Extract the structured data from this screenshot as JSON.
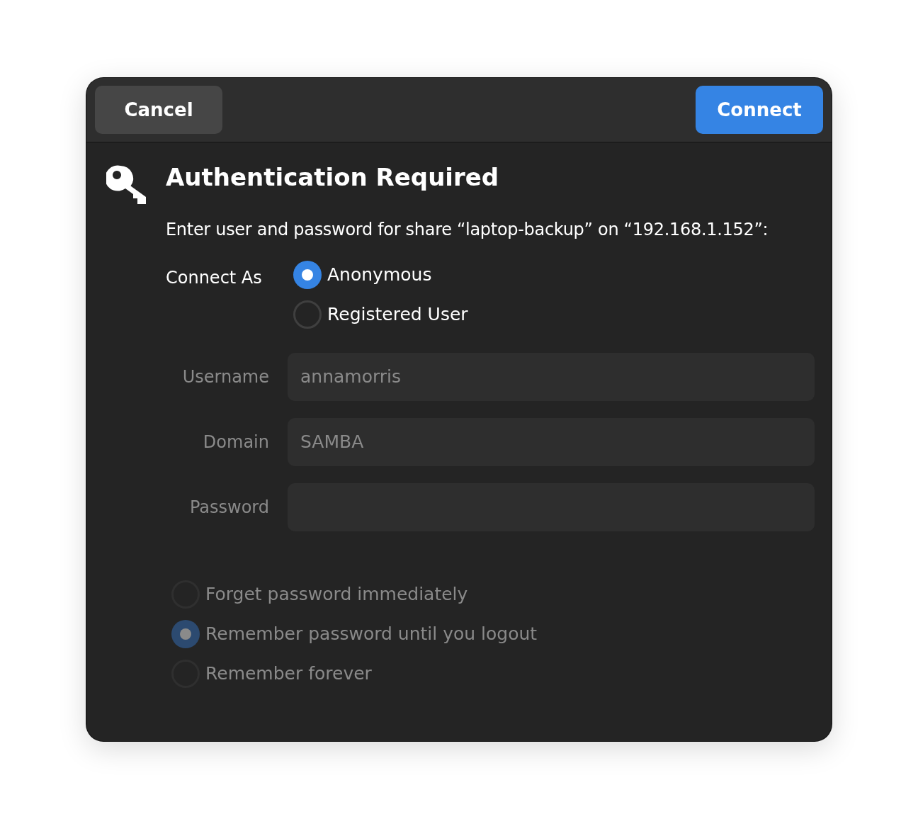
{
  "header": {
    "cancel": "Cancel",
    "connect": "Connect"
  },
  "title": "Authentication Required",
  "message": "Enter user and password for share “laptop-backup” on “192.168.1.152”:",
  "connect_as": {
    "label": "Connect As",
    "options": [
      {
        "label": "Anonymous",
        "selected": true
      },
      {
        "label": "Registered User",
        "selected": false
      }
    ]
  },
  "fields": [
    {
      "label": "Username",
      "value": "annamorris",
      "disabled": true
    },
    {
      "label": "Domain",
      "value": "SAMBA",
      "disabled": true
    },
    {
      "label": "Password",
      "disabled": true
    }
  ],
  "remember": {
    "disabled": true,
    "options": [
      {
        "label": "Forget password immediately",
        "selected": false
      },
      {
        "label": "Remember password until you logout",
        "selected": true
      },
      {
        "label": "Remember forever",
        "selected": false
      }
    ]
  }
}
